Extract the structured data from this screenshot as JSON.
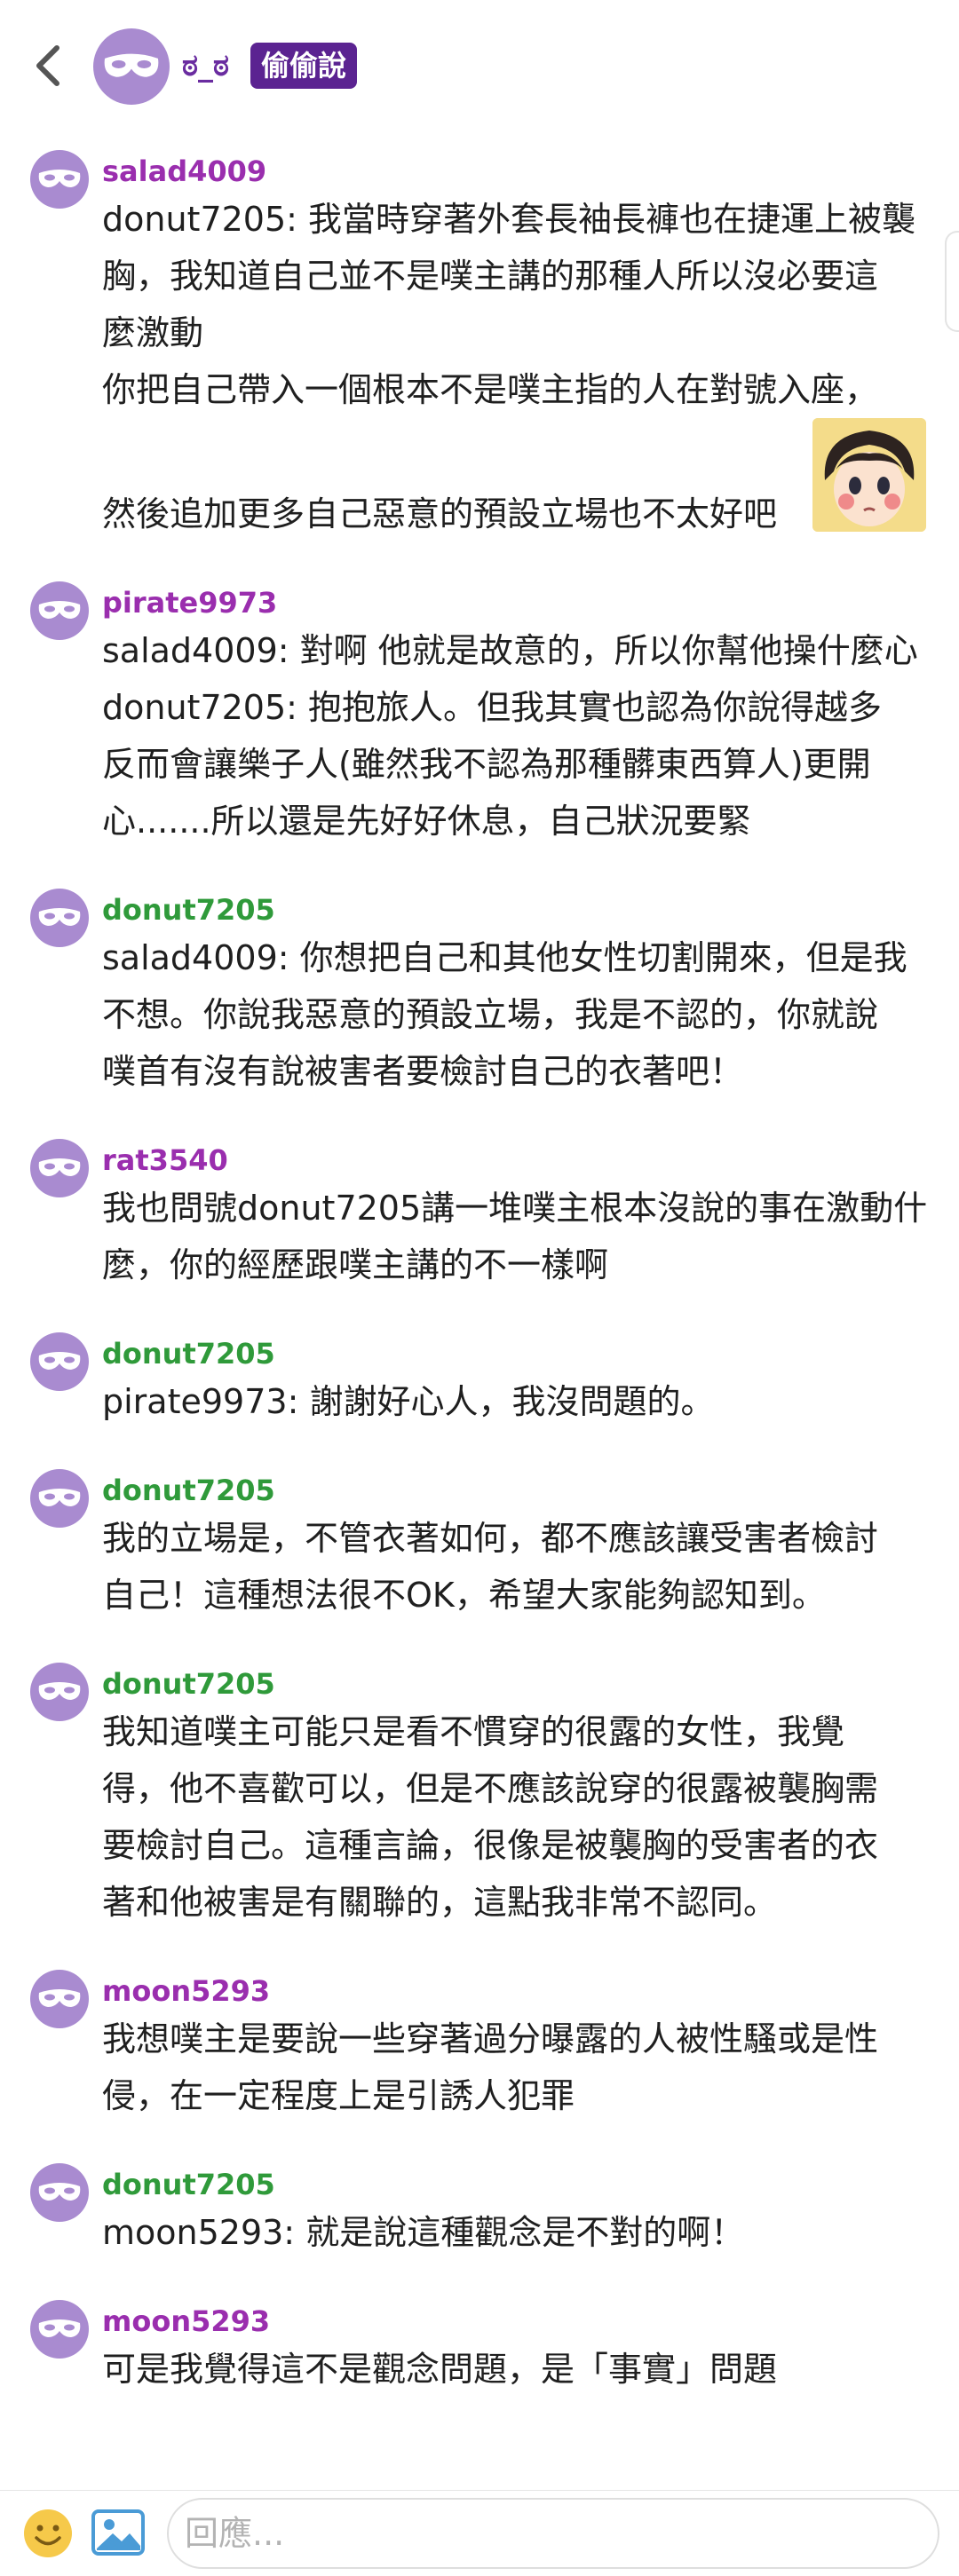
{
  "colors": {
    "accent_purple": "#5b2391",
    "username_purple": "#9a2eae",
    "username_green": "#2f9a3a",
    "avatar": "#a98bd0"
  },
  "header": {
    "back_icon": "chevron-left-icon",
    "avatar_icon": "mask-icon",
    "name": "ಠ_ಠ",
    "badge": "偷偷說"
  },
  "responses": [
    {
      "username": "salad4009",
      "color": "purple",
      "lines": [
        "donut7205: 我當時穿著外套長袖長褲也在捷運上被襲",
        "胸，我知道自己並不是噗主講的那種人所以沒必要這",
        "麼激動",
        "你把自己帶入一個根本不是噗主指的人在對號入座，",
        "然後追加更多自己惡意的預設立場也不太好吧"
      ],
      "sticker": "girl-sticker-icon"
    },
    {
      "username": "pirate9973",
      "color": "purple",
      "lines": [
        "salad4009: 對啊 他就是故意的，所以你幫他操什麼心",
        "donut7205: 抱抱旅人。但我其實也認為你說得越多",
        "反而會讓樂子人(雖然我不認為那種髒東西算人)更開",
        "心.......所以還是先好好休息，自己狀況要緊"
      ]
    },
    {
      "username": "donut7205",
      "color": "green",
      "lines": [
        "salad4009: 你想把自己和其他女性切割開來，但是我",
        "不想。你說我惡意的預設立場，我是不認的，你就說",
        "噗首有沒有說被害者要檢討自己的衣著吧！"
      ]
    },
    {
      "username": "rat3540",
      "color": "purple",
      "lines": [
        "我也問號donut7205講一堆噗主根本沒說的事在激動什",
        "麼，你的經歷跟噗主講的不一樣啊"
      ]
    },
    {
      "username": "donut7205",
      "color": "green",
      "lines": [
        "pirate9973: 謝謝好心人，我沒問題的。"
      ]
    },
    {
      "username": "donut7205",
      "color": "green",
      "lines": [
        "我的立場是，不管衣著如何，都不應該讓受害者檢討",
        "自己！這種想法很不OK，希望大家能夠認知到。"
      ]
    },
    {
      "username": "donut7205",
      "color": "green",
      "lines": [
        "我知道噗主可能只是看不慣穿的很露的女性，我覺",
        "得，他不喜歡可以，但是不應該說穿的很露被襲胸需",
        "要檢討自己。這種言論，很像是被襲胸的受害者的衣",
        "著和他被害是有關聯的，這點我非常不認同。"
      ]
    },
    {
      "username": "moon5293",
      "color": "purple",
      "lines": [
        "我想噗主是要說一些穿著過分曝露的人被性騷或是性",
        "侵，在一定程度上是引誘人犯罪"
      ]
    },
    {
      "username": "donut7205",
      "color": "green",
      "lines": [
        "moon5293: 就是說這種觀念是不對的啊！"
      ]
    },
    {
      "username": "moon5293",
      "color": "purple",
      "lines": [
        "可是我覺得這不是觀念問題，是「事實」問題"
      ]
    }
  ],
  "bottom_bar": {
    "emoji_icon": "emoji-icon",
    "image_icon": "image-icon",
    "reply_placeholder": "回應..."
  }
}
